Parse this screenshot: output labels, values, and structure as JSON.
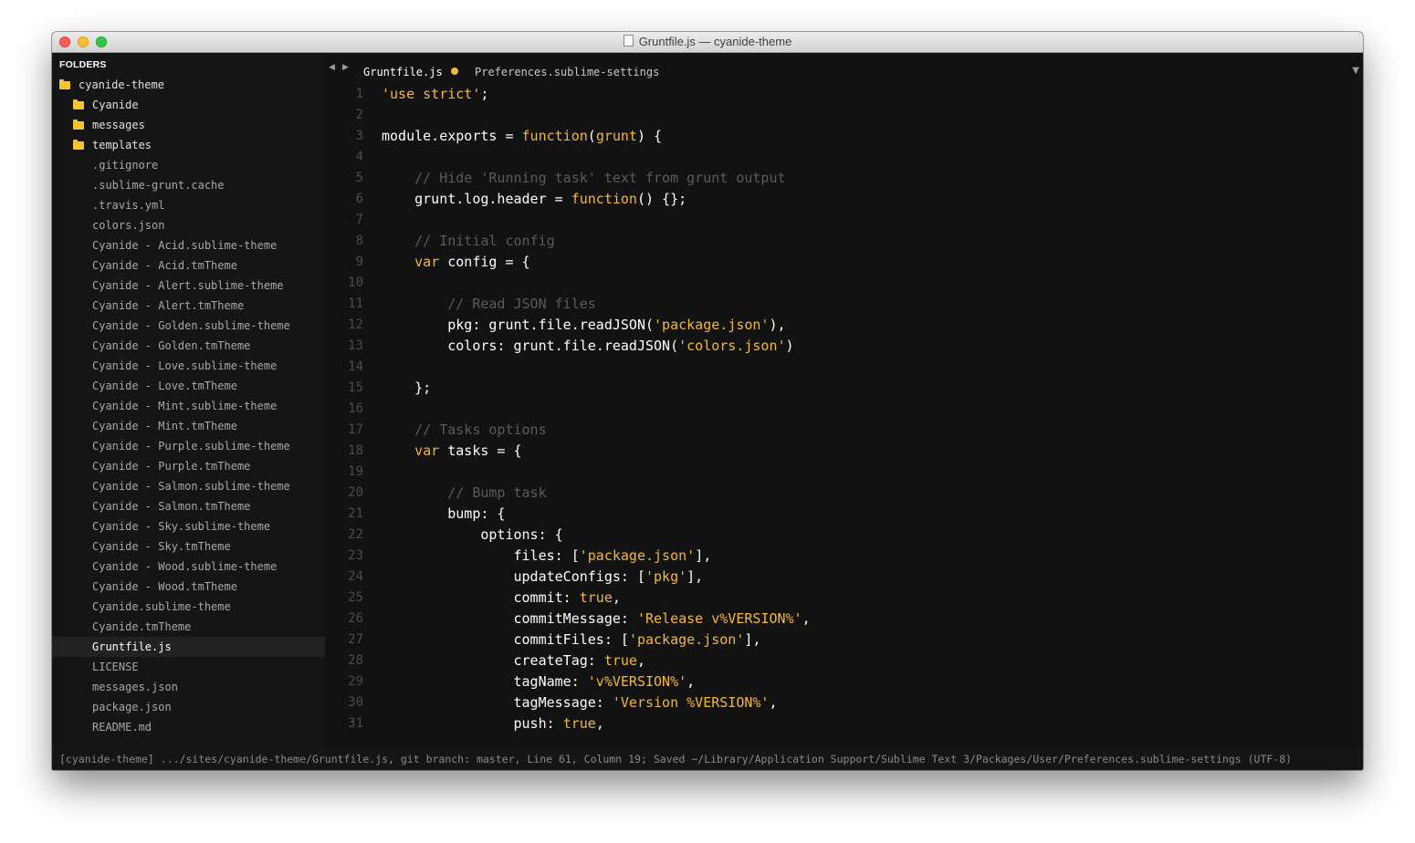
{
  "window": {
    "title": "Gruntfile.js — cyanide-theme"
  },
  "sidebar": {
    "header": "FOLDERS",
    "root": "cyanide-theme",
    "folders": [
      "Cyanide",
      "messages",
      "templates"
    ],
    "files": [
      ".gitignore",
      ".sublime-grunt.cache",
      ".travis.yml",
      "colors.json",
      "Cyanide - Acid.sublime-theme",
      "Cyanide - Acid.tmTheme",
      "Cyanide - Alert.sublime-theme",
      "Cyanide - Alert.tmTheme",
      "Cyanide - Golden.sublime-theme",
      "Cyanide - Golden.tmTheme",
      "Cyanide - Love.sublime-theme",
      "Cyanide - Love.tmTheme",
      "Cyanide - Mint.sublime-theme",
      "Cyanide - Mint.tmTheme",
      "Cyanide - Purple.sublime-theme",
      "Cyanide - Purple.tmTheme",
      "Cyanide - Salmon.sublime-theme",
      "Cyanide - Salmon.tmTheme",
      "Cyanide - Sky.sublime-theme",
      "Cyanide - Sky.tmTheme",
      "Cyanide - Wood.sublime-theme",
      "Cyanide - Wood.tmTheme",
      "Cyanide.sublime-theme",
      "Cyanide.tmTheme",
      "Gruntfile.js",
      "LICENSE",
      "messages.json",
      "package.json",
      "README.md"
    ],
    "selected_file": "Gruntfile.js"
  },
  "tabs": [
    {
      "label": "Gruntfile.js",
      "active": true,
      "dirty": true
    },
    {
      "label": "Preferences.sublime-settings",
      "active": false,
      "dirty": false
    }
  ],
  "editor": {
    "lines": [
      {
        "n": "1",
        "code": [
          {
            "t": "'use strict'",
            "c": "str"
          },
          {
            "t": ";"
          }
        ]
      },
      {
        "n": "2",
        "code": []
      },
      {
        "n": "3",
        "code": [
          {
            "t": "module.exports = "
          },
          {
            "t": "function",
            "c": "kw"
          },
          {
            "t": "("
          },
          {
            "t": "grunt",
            "c": "fn"
          },
          {
            "t": ") {"
          }
        ]
      },
      {
        "n": "4",
        "code": []
      },
      {
        "n": "5",
        "code": [
          {
            "t": "    "
          },
          {
            "t": "// Hide 'Running task' text from grunt output",
            "c": "com"
          }
        ]
      },
      {
        "n": "6",
        "code": [
          {
            "t": "    grunt.log.header = "
          },
          {
            "t": "function",
            "c": "kw"
          },
          {
            "t": "() {};"
          }
        ]
      },
      {
        "n": "7",
        "code": []
      },
      {
        "n": "8",
        "code": [
          {
            "t": "    "
          },
          {
            "t": "// Initial config",
            "c": "com"
          }
        ]
      },
      {
        "n": "9",
        "code": [
          {
            "t": "    "
          },
          {
            "t": "var",
            "c": "kw"
          },
          {
            "t": " config = {"
          }
        ]
      },
      {
        "n": "10",
        "code": []
      },
      {
        "n": "11",
        "code": [
          {
            "t": "        "
          },
          {
            "t": "// Read JSON files",
            "c": "com"
          }
        ]
      },
      {
        "n": "12",
        "code": [
          {
            "t": "        pkg: grunt.file.readJSON("
          },
          {
            "t": "'package.json'",
            "c": "str"
          },
          {
            "t": "),"
          }
        ]
      },
      {
        "n": "13",
        "code": [
          {
            "t": "        colors: grunt.file.readJSON("
          },
          {
            "t": "'colors.json'",
            "c": "str"
          },
          {
            "t": ")"
          }
        ]
      },
      {
        "n": "14",
        "code": []
      },
      {
        "n": "15",
        "code": [
          {
            "t": "    };"
          }
        ]
      },
      {
        "n": "16",
        "code": []
      },
      {
        "n": "17",
        "code": [
          {
            "t": "    "
          },
          {
            "t": "// Tasks options",
            "c": "com"
          }
        ]
      },
      {
        "n": "18",
        "code": [
          {
            "t": "    "
          },
          {
            "t": "var",
            "c": "kw"
          },
          {
            "t": " tasks = {"
          }
        ]
      },
      {
        "n": "19",
        "code": []
      },
      {
        "n": "20",
        "code": [
          {
            "t": "        "
          },
          {
            "t": "// Bump task",
            "c": "com"
          }
        ]
      },
      {
        "n": "21",
        "code": [
          {
            "t": "        bump: {"
          }
        ]
      },
      {
        "n": "22",
        "code": [
          {
            "t": "            options: {"
          }
        ]
      },
      {
        "n": "23",
        "code": [
          {
            "t": "                files: ["
          },
          {
            "t": "'package.json'",
            "c": "str"
          },
          {
            "t": "],"
          }
        ]
      },
      {
        "n": "24",
        "code": [
          {
            "t": "                updateConfigs: ["
          },
          {
            "t": "'pkg'",
            "c": "str"
          },
          {
            "t": "],"
          }
        ]
      },
      {
        "n": "25",
        "code": [
          {
            "t": "                commit: "
          },
          {
            "t": "true",
            "c": "kw"
          },
          {
            "t": ","
          }
        ]
      },
      {
        "n": "26",
        "code": [
          {
            "t": "                commitMessage: "
          },
          {
            "t": "'Release v%VERSION%'",
            "c": "str"
          },
          {
            "t": ","
          }
        ]
      },
      {
        "n": "27",
        "code": [
          {
            "t": "                commitFiles: ["
          },
          {
            "t": "'package.json'",
            "c": "str"
          },
          {
            "t": "],"
          }
        ]
      },
      {
        "n": "28",
        "code": [
          {
            "t": "                createTag: "
          },
          {
            "t": "true",
            "c": "kw"
          },
          {
            "t": ","
          }
        ]
      },
      {
        "n": "29",
        "code": [
          {
            "t": "                tagName: "
          },
          {
            "t": "'v%VERSION%'",
            "c": "str"
          },
          {
            "t": ","
          }
        ]
      },
      {
        "n": "30",
        "code": [
          {
            "t": "                tagMessage: "
          },
          {
            "t": "'Version %VERSION%'",
            "c": "str"
          },
          {
            "t": ","
          }
        ]
      },
      {
        "n": "31",
        "code": [
          {
            "t": "                push: "
          },
          {
            "t": "true",
            "c": "kw"
          },
          {
            "t": ","
          }
        ]
      }
    ]
  },
  "statusbar": {
    "text": "[cyanide-theme] .../sites/cyanide-theme/Gruntfile.js, git branch: master, Line 61, Column 19; Saved ~/Library/Application Support/Sublime Text 3/Packages/User/Preferences.sublime-settings (UTF-8)"
  },
  "colors": {
    "background": "#121212",
    "accent": "#f5b82e",
    "folder": "#f4c430",
    "comment": "#5a5a5a"
  }
}
